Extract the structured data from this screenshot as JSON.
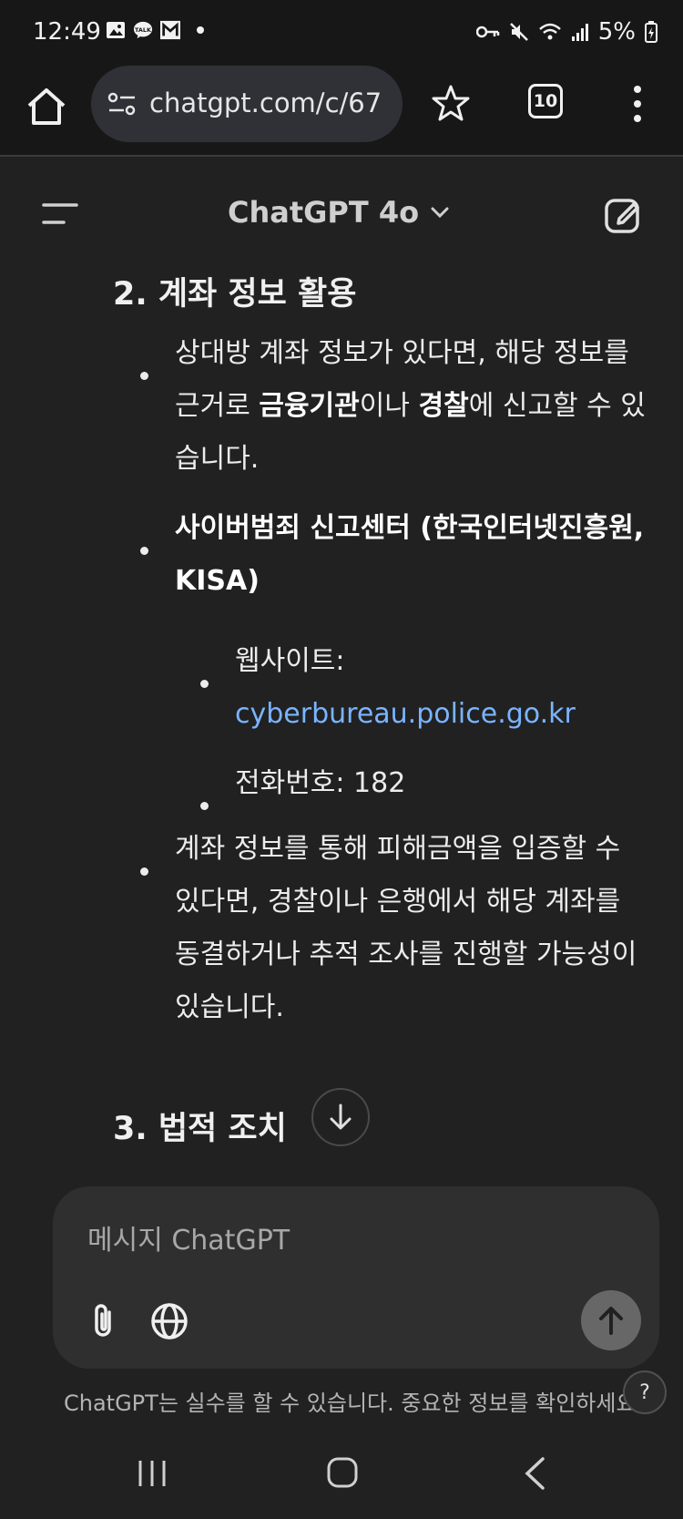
{
  "status_bar": {
    "time": "12:49",
    "battery": "5%",
    "icons_left": [
      "gallery-icon",
      "kakaotalk-icon",
      "gmail-icon",
      "dot-icon"
    ],
    "icons_right": [
      "key-icon",
      "mute-icon",
      "wifi-icon",
      "signal-icon",
      "battery-icon"
    ]
  },
  "browser": {
    "url": "chatgpt.com/c/67",
    "tab_count": "10"
  },
  "header": {
    "model": "ChatGPT 4o"
  },
  "content": {
    "section2_title": "2. 계좌 정보 활용",
    "b1_line1": "상대방 계좌 정보가 있다면, 해당 정보를",
    "b1_line2_pre": "근거로 ",
    "b1_line2_bold1": "금융기관",
    "b1_line2_mid": "이나 ",
    "b1_line2_bold2": "경찰",
    "b1_line2_post": "에 신고할 수 있",
    "b1_line3": "습니다.",
    "b2_line1": "사이버범죄 신고센터 (한국인터넷진흥원,",
    "b2_line2": "KISA)",
    "sub1_label": "웹사이트:",
    "sub1_link": "cyberbureau.police.go.kr",
    "sub2": "전화번호: 182",
    "b3_line1": "계좌 정보를 통해 피해금액을 입증할 수",
    "b3_line2": "있다면, 경찰이나 은행에서 해당 계좌를",
    "b3_line3": "동결하거나 추적 조사를 진행할 가능성이",
    "b3_line4": "있습니다.",
    "section3_title": "3. 법적 조치"
  },
  "composer": {
    "placeholder": "메시지 ChatGPT"
  },
  "disclaimer": "ChatGPT는 실수를 할 수 있습니다. 중요한 정보를 확인하세요.",
  "help": "?",
  "colors": {
    "background": "#212121",
    "link": "#7ab4ff",
    "composer": "#2f2f2f"
  }
}
